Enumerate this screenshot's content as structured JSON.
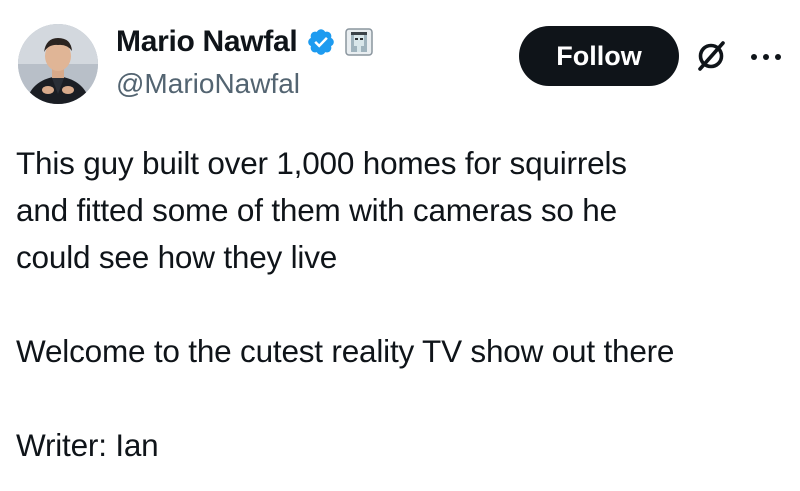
{
  "author": {
    "display_name": "Mario Nawfal",
    "handle": "@MarioNawfal",
    "avatar": "avatar-photo",
    "verified_badge": "verified-badge-icon",
    "affiliation_badge": "affiliate-badge-icon"
  },
  "actions": {
    "follow_label": "Follow",
    "grok_icon": "grok-icon",
    "more_icon": "more-icon"
  },
  "post": {
    "paragraphs": [
      "This guy built over 1,000 homes for squirrels\nand fitted some of them with cameras so he\ncould see how they live",
      "Welcome to the cutest reality TV show out there",
      "Writer: Ian"
    ]
  },
  "colors": {
    "text": "#0f1419",
    "secondary_text": "#536471",
    "verified_blue": "#1d9bf0",
    "follow_bg": "#0f1419",
    "follow_text": "#ffffff"
  }
}
